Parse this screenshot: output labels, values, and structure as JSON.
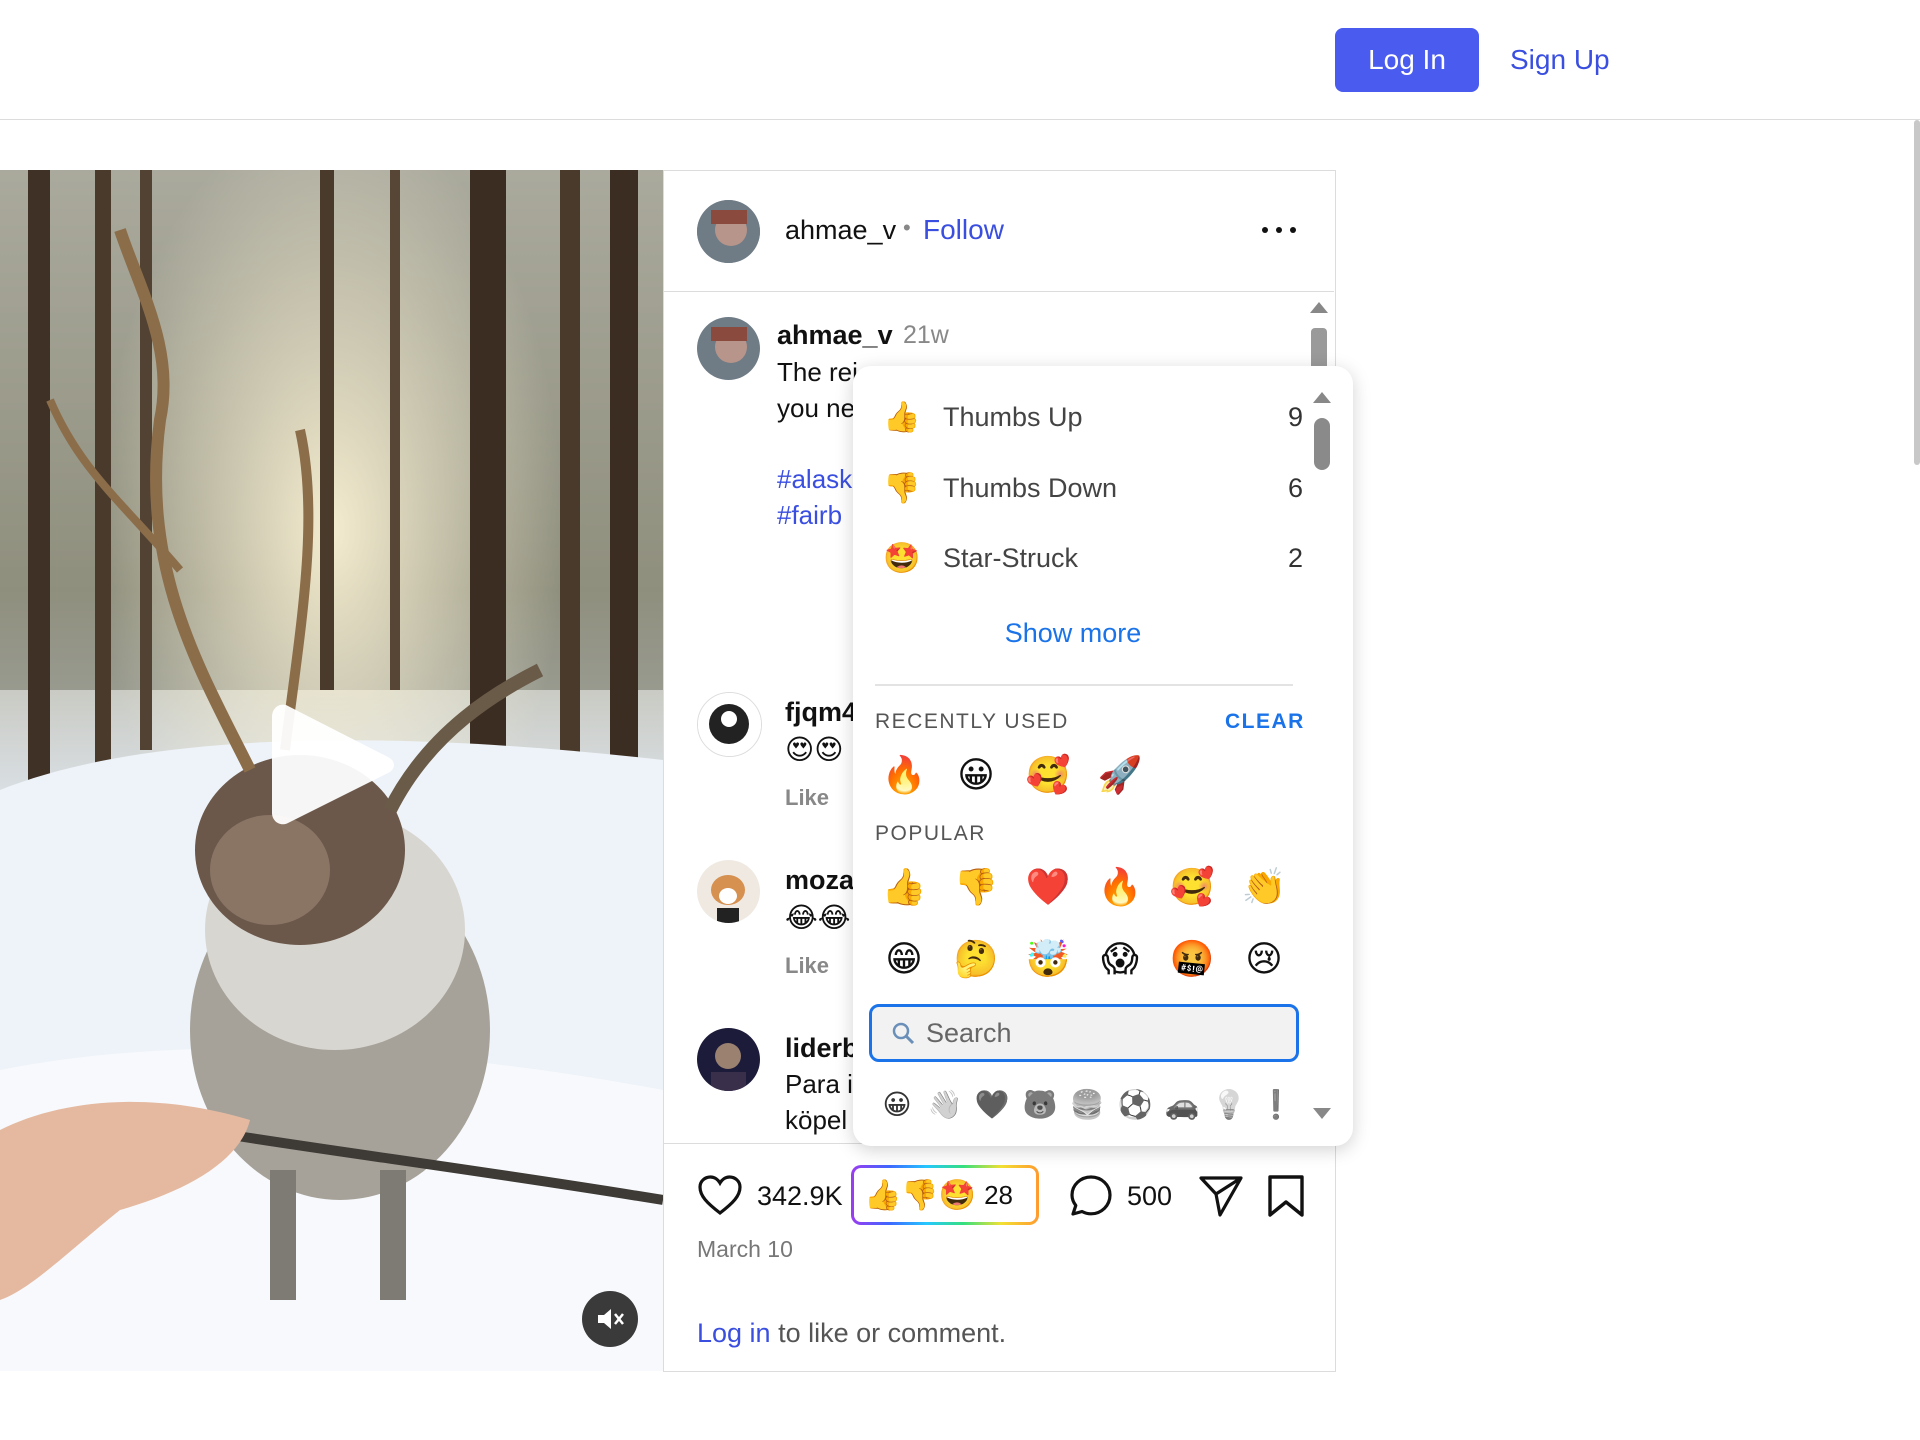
{
  "header": {
    "login_label": "Log In",
    "signup_label": "Sign Up"
  },
  "post": {
    "author": "ahmae_v",
    "follow_label": "Follow",
    "caption": {
      "user": "ahmae_v",
      "time": "21w",
      "line1": "The rei",
      "line2": "you ne",
      "hashtag1": "#alask",
      "hashtag2": "#fairb"
    },
    "comments": [
      {
        "user": "fjqm4",
        "text": "😍😍",
        "like": "Like"
      },
      {
        "user": "moza",
        "text": "😂😂",
        "like": "Like"
      },
      {
        "user": "liderb",
        "line1": "Para i",
        "line2": "köpel"
      }
    ],
    "likes_count": "342.9K",
    "reactions": {
      "emojis": "👍👎🤩",
      "count": "28"
    },
    "comments_count": "500",
    "date": "March 10",
    "login_prompt": {
      "link": "Log in",
      "rest": " to like or comment."
    }
  },
  "reaction_popup": {
    "reactions": [
      {
        "emoji": "👍",
        "name": "Thumbs Up",
        "count": "9"
      },
      {
        "emoji": "👎",
        "name": "Thumbs Down",
        "count": "6"
      },
      {
        "emoji": "🤩",
        "name": "Star-Struck",
        "count": "2"
      }
    ],
    "show_more": "Show more",
    "recently_used_label": "RECENTLY USED",
    "clear_label": "CLEAR",
    "recently_used": [
      "🔥",
      "😀",
      "🥰",
      "🚀"
    ],
    "popular_label": "POPULAR",
    "popular": [
      "👍",
      "👎",
      "❤️",
      "🔥",
      "🥰",
      "👏",
      "😁",
      "🤔",
      "🤯",
      "😱",
      "🤬",
      "😢"
    ],
    "search_placeholder": "Search",
    "categories": [
      "😀",
      "👋",
      "🖤",
      "🐻",
      "🍔",
      "⚽",
      "🚗",
      "💡",
      "❗"
    ]
  },
  "colors": {
    "accent": "#4a5cf0",
    "link": "#3a4fe0",
    "popup_link": "#1a73e8"
  }
}
